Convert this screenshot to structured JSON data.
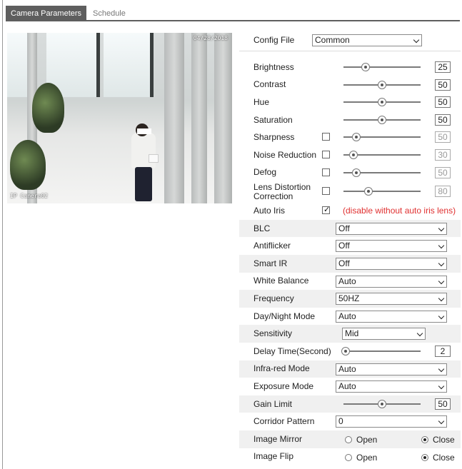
{
  "tabs": [
    {
      "label": "Camera Parameters"
    },
    {
      "label": "Schedule"
    }
  ],
  "preview": {
    "date": "04/28/2018",
    "camera_name": "IP Camera02"
  },
  "config_file": {
    "label": "Config File",
    "value": "Common"
  },
  "sliders": [
    {
      "label": "Brightness",
      "value": "25",
      "level": 0.29,
      "has_checkbox": false,
      "checked": false,
      "disabled": false
    },
    {
      "label": "Contrast",
      "value": "50",
      "level": 0.5,
      "has_checkbox": false,
      "checked": false,
      "disabled": false
    },
    {
      "label": "Hue",
      "value": "50",
      "level": 0.5,
      "has_checkbox": false,
      "checked": false,
      "disabled": false
    },
    {
      "label": "Saturation",
      "value": "50",
      "level": 0.5,
      "has_checkbox": false,
      "checked": false,
      "disabled": false
    },
    {
      "label": "Sharpness",
      "value": "50",
      "level": 0.17,
      "has_checkbox": true,
      "checked": false,
      "disabled": true
    },
    {
      "label": "Noise Reduction",
      "value": "30",
      "level": 0.13,
      "has_checkbox": true,
      "checked": false,
      "disabled": true
    },
    {
      "label": "Defog",
      "value": "50",
      "level": 0.17,
      "has_checkbox": true,
      "checked": false,
      "disabled": true
    },
    {
      "label": "Lens Distortion Correction",
      "value": "80",
      "level": 0.32,
      "has_checkbox": true,
      "checked": false,
      "disabled": true
    }
  ],
  "auto_iris": {
    "label": "Auto Iris",
    "checked": true,
    "note": "(disable without auto iris lens)"
  },
  "blc": {
    "label": "BLC",
    "value": "Off"
  },
  "antiflicker": {
    "label": "Antiflicker",
    "value": "Off"
  },
  "smart_ir": {
    "label": "Smart IR",
    "value": "Off"
  },
  "white_balance": {
    "label": "White Balance",
    "value": "Auto"
  },
  "frequency": {
    "label": "Frequency",
    "value": "50HZ"
  },
  "day_night": {
    "label": "Day/Night Mode",
    "value": "Auto"
  },
  "sensitivity": {
    "label": "Sensitivity",
    "value": "Mid"
  },
  "delay_time": {
    "label": "Delay Time(Second)",
    "value": "2",
    "level": 0.03
  },
  "infrared": {
    "label": "Infra-red Mode",
    "value": "Auto"
  },
  "exposure": {
    "label": "Exposure Mode",
    "value": "Auto"
  },
  "gain_limit": {
    "label": "Gain Limit",
    "value": "50",
    "level": 0.5
  },
  "corridor": {
    "label": "Corridor Pattern",
    "value": "0"
  },
  "image_mirror": {
    "label": "Image Mirror",
    "open": "Open",
    "close": "Close",
    "selected": "Close"
  },
  "image_flip": {
    "label": "Image Flip",
    "open": "Open",
    "close": "Close",
    "selected": "Close"
  }
}
